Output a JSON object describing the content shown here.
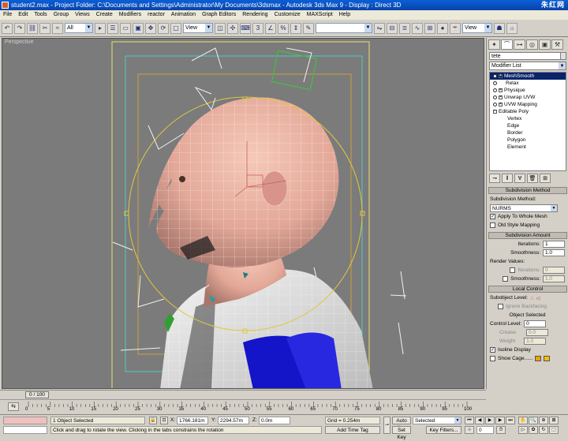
{
  "window": {
    "title": "student2.max - Project Folder: C:\\Documents and Settings\\Administrator\\My Documents\\3dsmax - Autodesk 3ds Max 9 - Display : Direct 3D",
    "watermark": "朱红网"
  },
  "menu": [
    "File",
    "Edit",
    "Tools",
    "Group",
    "Views",
    "Create",
    "Modifiers",
    "reactor",
    "Animation",
    "Graph Editors",
    "Rendering",
    "Customize",
    "MAXScript",
    "Help"
  ],
  "toolbar": {
    "selection_filter": "All",
    "reference_coord": "View",
    "named_selection": "",
    "view_dropdown": "View"
  },
  "viewport": {
    "label": "Perspective"
  },
  "command_panel": {
    "object_name": "tete",
    "modifier_list": "Modifier List",
    "stack": [
      {
        "label": "MeshSmooth",
        "selected": true
      },
      {
        "label": "Relax",
        "selected": false
      },
      {
        "label": "Physique",
        "selected": false
      },
      {
        "label": "Unwrap UVW",
        "selected": false
      },
      {
        "label": "UVW Mapping",
        "selected": false
      },
      {
        "label": "Editable Poly",
        "selected": false
      }
    ],
    "subobjects": [
      "Vertex",
      "Edge",
      "Border",
      "Polygon",
      "Element"
    ],
    "subdivision_method": {
      "title": "Subdivision Method",
      "label": "Subdivision Method:",
      "value": "NURMS",
      "apply_whole_mesh": "Apply To Whole Mesh",
      "old_style": "Old Style Mapping"
    },
    "subdivision_amount": {
      "title": "Subdivision Amount",
      "iterations_label": "Iterations:",
      "iterations": "1",
      "smoothness_label": "Smoothness:",
      "smoothness": "1.0",
      "render_values": "Render Values:",
      "r_iterations_label": "Iterations:",
      "r_iterations": "0",
      "r_smoothness_label": "Smoothness:",
      "r_smoothness": "1.0"
    },
    "local_control": {
      "title": "Local Control",
      "subobject_level": "Subobject Level:",
      "ignore_backfacing": "Ignore Backfacing",
      "object_selected": "Object Selected",
      "control_level_label": "Control Level:",
      "control_level": "0",
      "crease_label": "Crease",
      "crease": "0.0",
      "weight_label": "Weight",
      "weight": "1.0",
      "isoline_display": "Isoline Display",
      "show_cage": "Show Cage......"
    }
  },
  "timeline": {
    "slider": "0 / 100",
    "ticks": [
      "0",
      "5",
      "10",
      "15",
      "20",
      "25",
      "30",
      "35",
      "40",
      "45",
      "50",
      "55",
      "60",
      "65",
      "70",
      "75",
      "80",
      "85",
      "90",
      "95",
      "100"
    ]
  },
  "status": {
    "selection": "1 Object Selected",
    "prompt": "Click and drag to rotate the view.  Clicking in the tabs constrains the rotation",
    "x_label": "X:",
    "x_value": "1766.181m",
    "y_label": "Y:",
    "y_value": "2294.57m",
    "z_label": "Z:",
    "z_value": "0.0m",
    "grid": "Grid = 0.254m",
    "add_time_tag": "Add Time Tag",
    "auto_key": "Auto Key",
    "set_key": "Set Key",
    "key_mode": "Selected",
    "key_filters": "Key Filters...",
    "frame": "0"
  }
}
